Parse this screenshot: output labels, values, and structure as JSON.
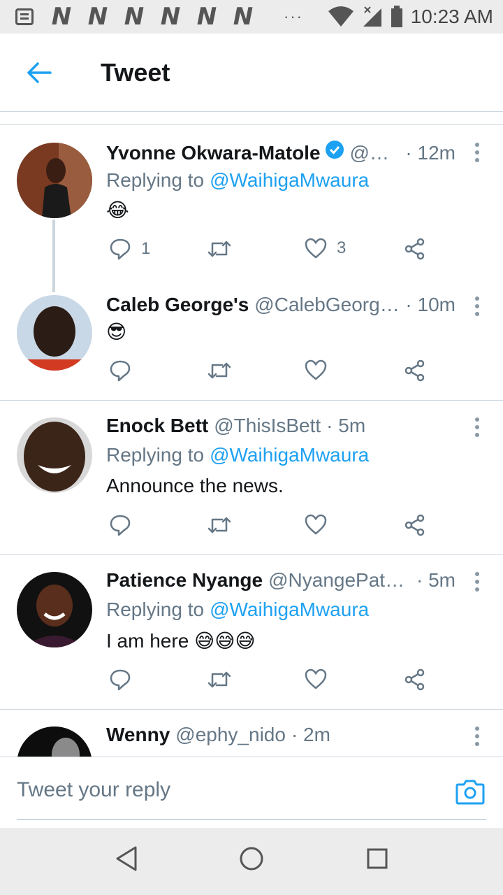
{
  "status_bar": {
    "notif_letters": [
      "N",
      "N",
      "N",
      "N",
      "N",
      "N"
    ],
    "overflow": "···",
    "time": "10:23 AM"
  },
  "app_bar": {
    "title": "Tweet"
  },
  "tweets": [
    {
      "name": "Yvonne Okwara-Matole",
      "verified": true,
      "handle": "@…",
      "time": "· 12m",
      "replying_label": "Replying to",
      "replying_to": "@WaihigaMwaura",
      "text": "😂",
      "reply_count": "1",
      "like_count": "3"
    },
    {
      "name": "Caleb George's",
      "handle": "@CalebGeorg…",
      "time": "· 10m",
      "text": "😎",
      "reply_count": "",
      "like_count": ""
    },
    {
      "name": "Enock Bett",
      "handle": "@ThisIsBett",
      "time": "· 5m",
      "replying_label": "Replying to",
      "replying_to": "@WaihigaMwaura",
      "text": "Announce the news.",
      "reply_count": "",
      "like_count": ""
    },
    {
      "name": "Patience Nyange",
      "handle": "@NyangePat…",
      "time": "· 5m",
      "replying_label": "Replying to",
      "replying_to": "@WaihigaMwaura",
      "text": "I am here 😅😅😅",
      "reply_count": "",
      "like_count": ""
    },
    {
      "name": "Wenny",
      "handle": "@ephy_nido",
      "time": "· 2m"
    }
  ],
  "reply_bar": {
    "placeholder": "Tweet your reply"
  },
  "colors": {
    "accent": "#1da1f2",
    "muted": "#657786",
    "divider": "#ccd6dd"
  },
  "icons": [
    "back-arrow-icon",
    "reply-icon",
    "retweet-icon",
    "like-icon",
    "share-icon",
    "more-icon",
    "camera-icon",
    "verified-icon",
    "nav-back-icon",
    "nav-home-icon",
    "nav-recents-icon"
  ]
}
